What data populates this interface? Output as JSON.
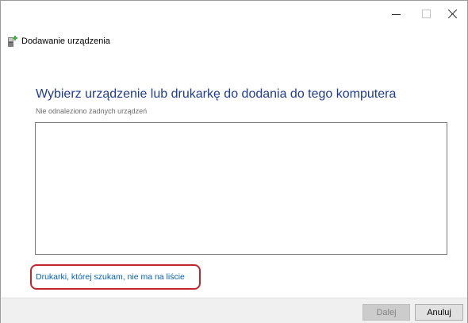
{
  "window": {
    "title": "Dodawanie urządzenia"
  },
  "caption_buttons": {
    "minimize_icon": "minimize-icon",
    "maximize_icon": "maximize-icon",
    "close_icon": "close-icon"
  },
  "main": {
    "heading": "Wybierz urządzenie lub drukarkę do dodania do tego komputera",
    "subheading": "Nie odnaleziono żadnych urządzeń",
    "device_list_items": [],
    "missing_printer_link": "Drukarki, której szukam, nie ma na liście"
  },
  "footer": {
    "next_label": "Dalej",
    "next_enabled": false,
    "cancel_label": "Anuluj"
  },
  "colors": {
    "heading": "#1e3c96",
    "link": "#0060b8",
    "highlight": "#c0272d",
    "footer_bg": "#f0f0f0"
  }
}
